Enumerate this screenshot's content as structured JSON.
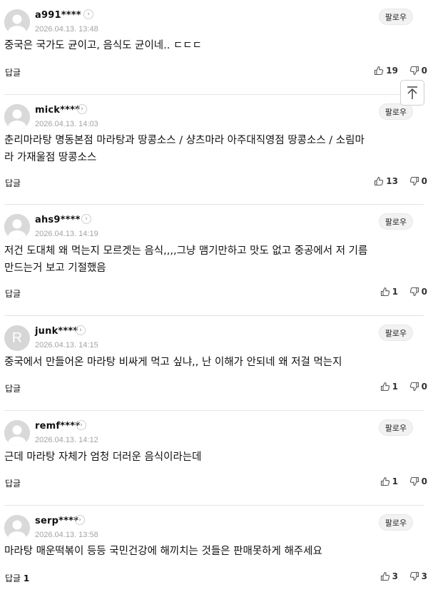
{
  "follow_label": "팔로우",
  "reply_label": "답글",
  "comments": [
    {
      "username": "a991****",
      "date": "2026.04.13. 13:48",
      "text": "중국은 국가도 균이고, 음식도 균이네.. ㄷㄷㄷ",
      "reply_count": "",
      "likes": "19",
      "dislikes": "0",
      "avatar": "default"
    },
    {
      "username": "mick****",
      "date": "2026.04.13. 14:03",
      "text": "춘리마라탕 명동본점 마라탕과 땅콩소스 / 샹츠마라 아주대직영점 땅콩소스 / 소림마\n라 가재울점 땅콩소스",
      "reply_count": "",
      "likes": "13",
      "dislikes": "0",
      "avatar": "default"
    },
    {
      "username": "ahs9****",
      "date": "2026.04.13. 14:19",
      "text": "저건 도대체 왜 먹는지 모르겟는 음식,,,,그냥 맴기만하고 맛도 없고 중공에서 저 기름\n만드는거 보고 기절했음",
      "reply_count": "",
      "likes": "1",
      "dislikes": "0",
      "avatar": "default"
    },
    {
      "username": "junk****",
      "date": "2026.04.13. 14:15",
      "text": "중국에서 만들어온 마라탕 비싸게 먹고 싶냐,, 난 이해가 안되네 왜 저걸 먹는지",
      "reply_count": "",
      "likes": "1",
      "dislikes": "0",
      "avatar": "R"
    },
    {
      "username": "remf****",
      "date": "2026.04.13. 14:12",
      "text": "근데 마라탕 자체가 엄청 더러운 음식이라는데",
      "reply_count": "",
      "likes": "1",
      "dislikes": "0",
      "avatar": "default"
    },
    {
      "username": "serp****",
      "date": "2026.04.13. 13:58",
      "text": "마라탕 매운떡볶이 등등 국민건강에 해끼치는 것들은 판매못하게 해주세요",
      "reply_count": "1",
      "likes": "3",
      "dislikes": "3",
      "avatar": "default"
    }
  ],
  "top_button_icon": "arrow-up-to-top-icon"
}
